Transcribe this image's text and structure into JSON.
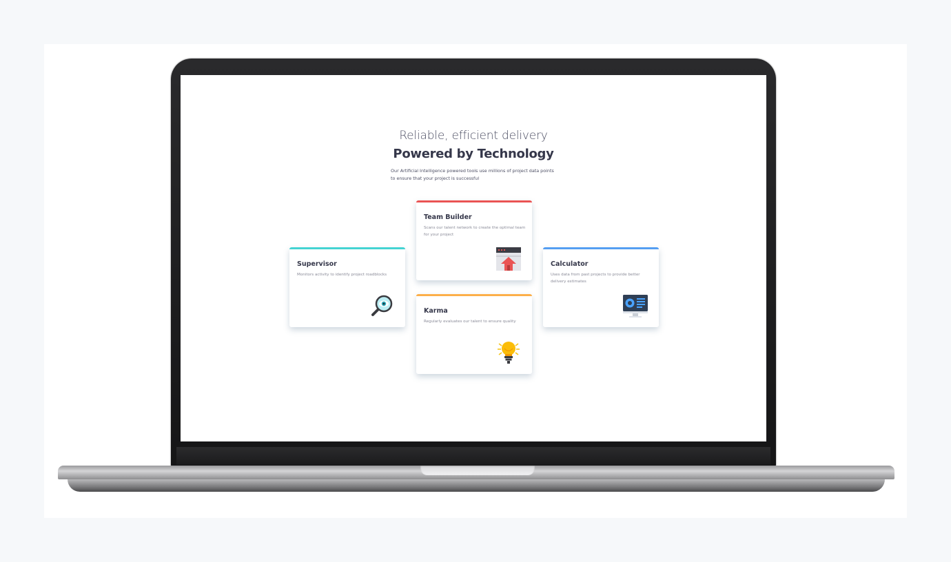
{
  "hero": {
    "subtitle": "Reliable, efficient delivery",
    "title": "Powered by Technology",
    "intro": "Our Artificial Intelligence powered tools use millions of project data points to ensure that your project is successful"
  },
  "cards": {
    "supervisor": {
      "title": "Supervisor",
      "description": "Monitors activity to identify project roadblocks",
      "accent": "#44d3d2",
      "icon": "magnifier-eye-icon"
    },
    "team_builder": {
      "title": "Team Builder",
      "description": "Scans our talent network to create the optimal team for your project",
      "accent": "#ea5454",
      "icon": "browser-upload-icon"
    },
    "karma": {
      "title": "Karma",
      "description": "Regularly evaluates our talent to ensure quality",
      "accent": "#fcaf4a",
      "icon": "lightbulb-icon"
    },
    "calculator": {
      "title": "Calculator",
      "description": "Uses data from past projects to provide better delivery estimates",
      "accent": "#549ef2",
      "icon": "monitor-chart-icon"
    }
  }
}
